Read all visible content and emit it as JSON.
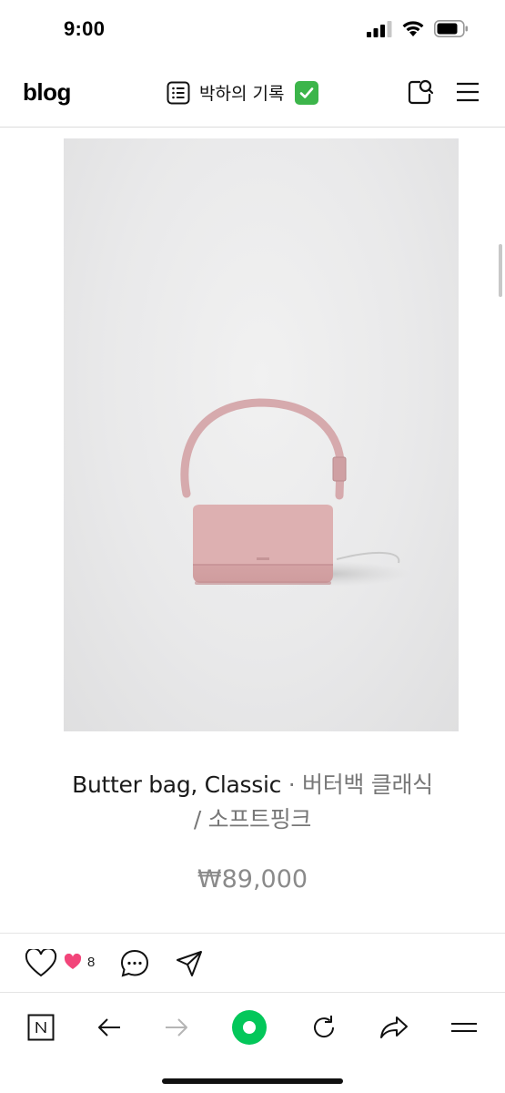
{
  "status_bar": {
    "time": "9:00"
  },
  "header": {
    "logo": "blog",
    "blog_title": "박하의 기록"
  },
  "product": {
    "name_en": "Butter bag, Classic",
    "separator": " · ",
    "name_ko_line1": "버터백 클래식",
    "name_ko_line2": "/ 소프트핑크",
    "price": "₩89,000"
  },
  "actions": {
    "like_count": "8"
  },
  "colors": {
    "badge_green": "#3cb54a",
    "naver_green": "#03c75a",
    "heart_pink": "#f2457a",
    "price_gray": "#8a8a8a",
    "bag_pink": "#dba9aa"
  }
}
